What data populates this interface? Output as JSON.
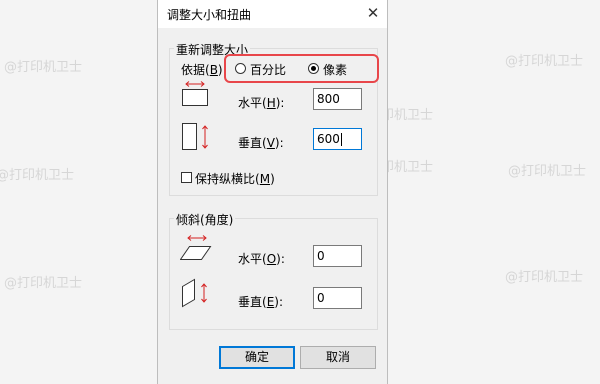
{
  "watermark": "@打印机卫士",
  "dialog": {
    "title": "调整大小和扭曲",
    "close_glyph": "✕"
  },
  "resize": {
    "group_label": "重新调整大小",
    "basis_label": "依据(B):",
    "basis_key": "B",
    "options": [
      {
        "label": "百分比",
        "selected": false
      },
      {
        "label": "像素",
        "selected": true
      }
    ],
    "horizontal": {
      "label": "水平",
      "key": "H",
      "value": "800"
    },
    "vertical": {
      "label": "垂直",
      "key": "V",
      "value": "600"
    },
    "keep_ratio": {
      "label": "保持纵横比",
      "key": "M",
      "checked": false
    }
  },
  "skew": {
    "group_label": "倾斜(角度)",
    "horizontal": {
      "label": "水平",
      "key": "O",
      "value": "0"
    },
    "vertical": {
      "label": "垂直",
      "key": "E",
      "value": "0"
    }
  },
  "buttons": {
    "ok": "确定",
    "cancel": "取消"
  },
  "colors": {
    "highlight": "#e8464a",
    "arrow": "#d42020",
    "focus": "#0078d7"
  },
  "icons": {
    "resize_horizontal": "resize-horizontal-icon",
    "resize_vertical": "resize-vertical-icon",
    "skew_horizontal": "skew-horizontal-icon",
    "skew_vertical": "skew-vertical-icon"
  }
}
